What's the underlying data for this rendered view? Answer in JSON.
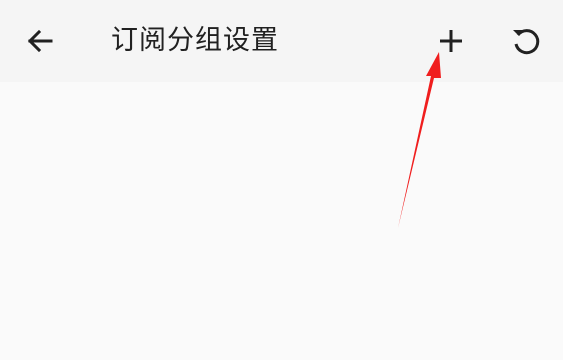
{
  "toolbar": {
    "title": "订阅分组设置",
    "back_icon": "arrow-back-icon",
    "add_icon": "add-icon",
    "refresh_icon": "refresh-icon"
  },
  "colors": {
    "toolbar_bg": "#f5f5f5",
    "page_bg": "#fafafa",
    "text": "#212121",
    "annotation": "#f01e1e"
  }
}
